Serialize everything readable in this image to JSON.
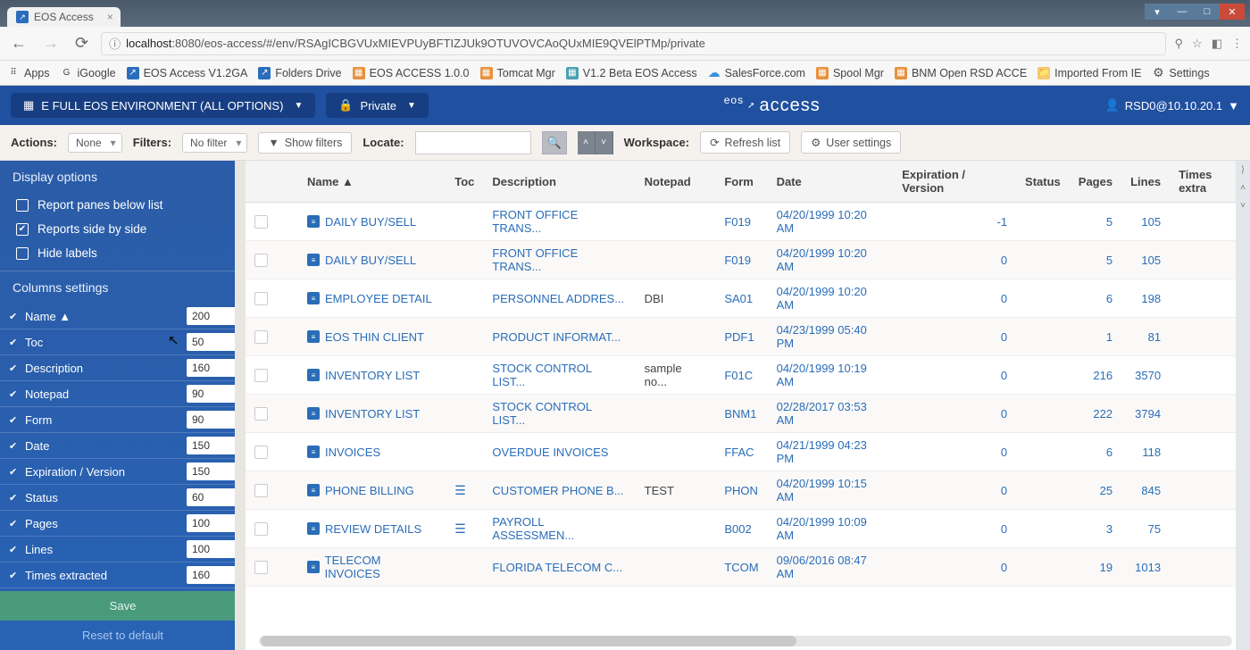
{
  "browser": {
    "tab_title": "EOS Access",
    "url_host": "localhost",
    "url_port": ":8080",
    "url_path": "/eos-access/#/env/RSAgICBGVUxMIEVPUyBFTIZJUk9OTUVOVCAoQUxMIE9QVElPTMp/private",
    "bookmarks": [
      {
        "label": "Apps",
        "icon": "apps"
      },
      {
        "label": "iGoogle",
        "icon": "g"
      },
      {
        "label": "EOS Access V1.2GA",
        "icon": "blue"
      },
      {
        "label": "Folders Drive",
        "icon": "blue"
      },
      {
        "label": "EOS ACCESS 1.0.0",
        "icon": "orange"
      },
      {
        "label": "Tomcat Mgr",
        "icon": "orange"
      },
      {
        "label": "V1.2 Beta EOS Access",
        "icon": "teal"
      },
      {
        "label": "SalesForce.com",
        "icon": "cloud"
      },
      {
        "label": "Spool Mgr",
        "icon": "orange"
      },
      {
        "label": "BNM Open RSD ACCE",
        "icon": "orange"
      },
      {
        "label": "Imported From IE",
        "icon": "folder"
      },
      {
        "label": "Settings",
        "icon": "gear"
      }
    ]
  },
  "header": {
    "env_label": "E FULL EOS ENVIRONMENT (ALL OPTIONS)",
    "private_label": "Private",
    "logo": "access",
    "logo_prefix": "eos",
    "user": "RSD0@10.10.20.1"
  },
  "actionbar": {
    "actions_label": "Actions:",
    "actions_value": "None",
    "filters_label": "Filters:",
    "filters_value": "No filter",
    "show_filters": "Show filters",
    "locate_label": "Locate:",
    "workspace_label": "Workspace:",
    "refresh": "Refresh list",
    "user_settings": "User settings"
  },
  "sidebar": {
    "display_options": "Display options",
    "opts": [
      {
        "label": "Report panes below list",
        "checked": false
      },
      {
        "label": "Reports side by side",
        "checked": true
      },
      {
        "label": "Hide labels",
        "checked": false
      }
    ],
    "columns_title": "Columns settings",
    "cols": [
      {
        "name": "Name ▲",
        "val": "200"
      },
      {
        "name": "Toc",
        "val": "50"
      },
      {
        "name": "Description",
        "val": "160"
      },
      {
        "name": "Notepad",
        "val": "90"
      },
      {
        "name": "Form",
        "val": "90"
      },
      {
        "name": "Date",
        "val": "150"
      },
      {
        "name": "Expiration / Version",
        "val": "150"
      },
      {
        "name": "Status",
        "val": "60"
      },
      {
        "name": "Pages",
        "val": "100"
      },
      {
        "name": "Lines",
        "val": "100"
      },
      {
        "name": "Times extracted",
        "val": "160"
      }
    ],
    "save": "Save",
    "reset": "Reset to default"
  },
  "table": {
    "headers": [
      "Name ▲",
      "Toc",
      "Description",
      "Notepad",
      "Form",
      "Date",
      "Expiration / Version",
      "Status",
      "Pages",
      "Lines",
      "Times extra"
    ],
    "rows": [
      {
        "name": "DAILY BUY/SELL",
        "toc": "",
        "desc": "FRONT OFFICE TRANS...",
        "note": "",
        "form": "F019",
        "date": "04/20/1999 10:20 AM",
        "exp": "-1",
        "status": "",
        "pages": "5",
        "lines": "105"
      },
      {
        "name": "DAILY BUY/SELL",
        "toc": "",
        "desc": "FRONT OFFICE TRANS...",
        "note": "",
        "form": "F019",
        "date": "04/20/1999 10:20 AM",
        "exp": "0",
        "status": "",
        "pages": "5",
        "lines": "105"
      },
      {
        "name": "EMPLOYEE DETAIL",
        "toc": "",
        "desc": "PERSONNEL ADDRES...",
        "note": "DBI",
        "form": "SA01",
        "date": "04/20/1999 10:20 AM",
        "exp": "0",
        "status": "",
        "pages": "6",
        "lines": "198"
      },
      {
        "name": "EOS THIN CLIENT",
        "toc": "",
        "desc": "PRODUCT INFORMAT...",
        "note": "",
        "form": "PDF1",
        "date": "04/23/1999 05:40 PM",
        "exp": "0",
        "status": "",
        "pages": "1",
        "lines": "81"
      },
      {
        "name": "INVENTORY LIST",
        "toc": "",
        "desc": "STOCK CONTROL LIST...",
        "note": "sample no...",
        "form": "F01C",
        "date": "04/20/1999 10:19 AM",
        "exp": "0",
        "status": "",
        "pages": "216",
        "lines": "3570"
      },
      {
        "name": "INVENTORY LIST",
        "toc": "",
        "desc": "STOCK CONTROL LIST...",
        "note": "",
        "form": "BNM1",
        "date": "02/28/2017 03:53 AM",
        "exp": "0",
        "status": "",
        "pages": "222",
        "lines": "3794"
      },
      {
        "name": "INVOICES",
        "toc": "",
        "desc": "OVERDUE INVOICES",
        "note": "",
        "form": "FFAC",
        "date": "04/21/1999 04:23 PM",
        "exp": "0",
        "status": "",
        "pages": "6",
        "lines": "118"
      },
      {
        "name": "PHONE BILLING",
        "toc": "y",
        "desc": "CUSTOMER PHONE B...",
        "note": "TEST",
        "form": "PHON",
        "date": "04/20/1999 10:15 AM",
        "exp": "0",
        "status": "",
        "pages": "25",
        "lines": "845"
      },
      {
        "name": "REVIEW DETAILS",
        "toc": "y",
        "desc": "PAYROLL ASSESSMEN...",
        "note": "",
        "form": "B002",
        "date": "04/20/1999 10:09 AM",
        "exp": "0",
        "status": "",
        "pages": "3",
        "lines": "75"
      },
      {
        "name": "TELECOM INVOICES",
        "toc": "",
        "desc": "FLORIDA TELECOM C...",
        "note": "",
        "form": "TCOM",
        "date": "09/06/2016 08:47 AM",
        "exp": "0",
        "status": "",
        "pages": "19",
        "lines": "1013"
      }
    ]
  }
}
